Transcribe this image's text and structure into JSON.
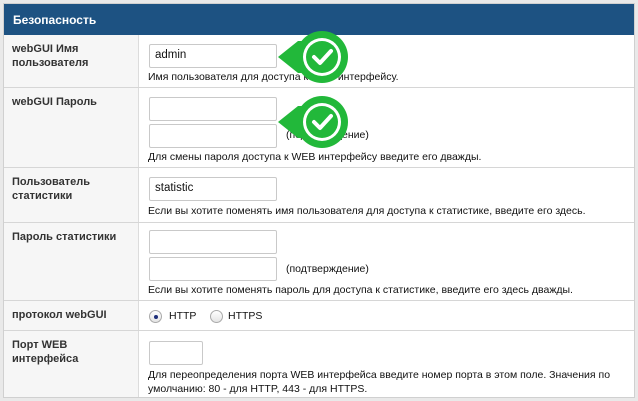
{
  "section_title": "Безопасность",
  "rows": {
    "username": {
      "label": "webGUI Имя пользователя",
      "value": "admin",
      "help": "Имя пользователя для доступа к WEB интерфейсу."
    },
    "password": {
      "label": "webGUI Пароль",
      "confirm": "(подтверждение)",
      "help": "Для смены пароля доступа к WEB интерфейсу введите его дважды."
    },
    "stat_user": {
      "label": "Пользователь статистики",
      "value": "statistic",
      "help": "Если вы хотите поменять имя пользователя для доступа к статистике, введите его здесь."
    },
    "stat_pass": {
      "label": "Пароль статистики",
      "confirm": "(подтверждение)",
      "help": "Если вы хотите поменять пароль для доступа к статистике, введите его здесь дважды."
    },
    "protocol": {
      "label": "протокол webGUI",
      "options": [
        "HTTP",
        "HTTPS"
      ],
      "selected": "HTTP"
    },
    "port": {
      "label": "Порт WEB интерфейса",
      "value": "",
      "help1": "Для переопределения порта WEB интерфейса введите номер порта в этом поле. Значения по",
      "help2": "умолчанию: 80 - для HTTP, 443 - для HTTPS."
    }
  },
  "colors": {
    "header": "#1d5282",
    "badge": "#22b83a"
  }
}
